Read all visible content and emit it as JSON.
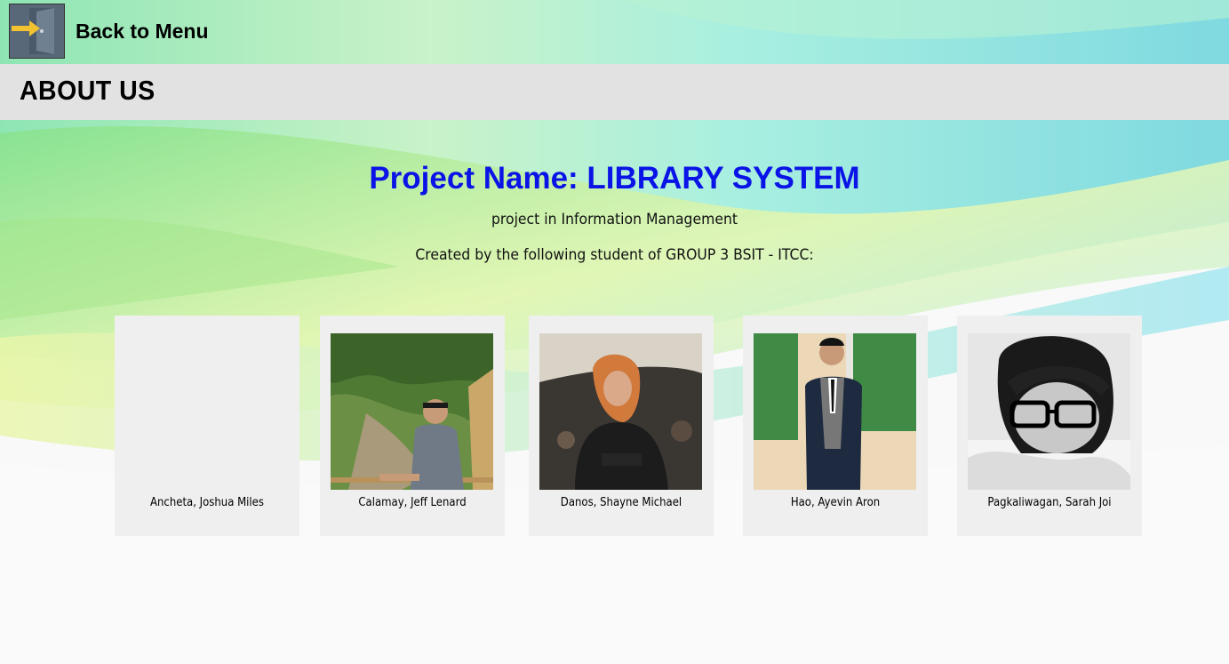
{
  "header": {
    "back_label": "Back to Menu",
    "back_icon": "door-exit-icon",
    "page_title": "ABOUT US"
  },
  "intro": {
    "project_name": "Project Name: LIBRARY SYSTEM",
    "subtitle": "project in Information Management",
    "created_by": "Created by the following student of GROUP 3 BSIT - ITCC:"
  },
  "members": [
    {
      "name": "Ancheta, Joshua Miles"
    },
    {
      "name": "Calamay, Jeff Lenard"
    },
    {
      "name": "Danos, Shayne Michael"
    },
    {
      "name": "Hao, Ayevin Aron"
    },
    {
      "name": "Pagkaliwagan, Sarah Joi"
    }
  ],
  "colors": {
    "title_blue": "#0a14e6",
    "header_band": "#e2e2e2",
    "card_bg": "#efefef"
  }
}
